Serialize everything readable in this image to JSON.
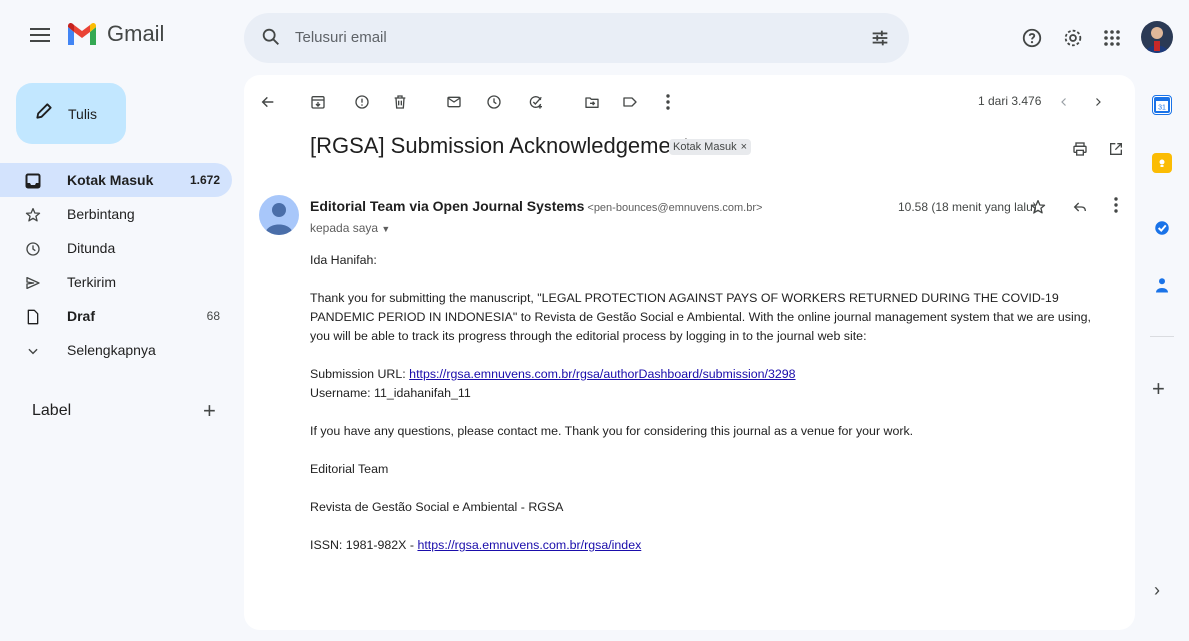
{
  "app": {
    "name": "Gmail"
  },
  "search": {
    "placeholder": "Telusuri email"
  },
  "compose": {
    "label": "Tulis"
  },
  "sidebar": {
    "items": [
      {
        "label": "Kotak Masuk",
        "count": "1.672",
        "icon": "inbox-icon"
      },
      {
        "label": "Berbintang",
        "count": "",
        "icon": "star-icon"
      },
      {
        "label": "Ditunda",
        "count": "",
        "icon": "clock-icon"
      },
      {
        "label": "Terkirim",
        "count": "",
        "icon": "send-icon"
      },
      {
        "label": "Draf",
        "count": "68",
        "icon": "draft-icon"
      },
      {
        "label": "Selengkapnya",
        "count": "",
        "icon": "chevron-down-icon"
      }
    ],
    "label_heading": "Label",
    "label_add": "+"
  },
  "toolbar": {
    "pager": "1 dari 3.476"
  },
  "email": {
    "subject": "[RGSA] Submission Acknowledgement",
    "tag": "Kotak Masuk",
    "tag_close": "×",
    "sender_name": "Editorial Team via Open Journal Systems",
    "sender_email": "<pen-bounces@emnuvens.com.br>",
    "to": "kepada saya",
    "time": "10.58 (18 menit yang lalu)",
    "greeting": "Ida Hanifah:",
    "paragraph1": "Thank you for submitting the manuscript, \"LEGAL PROTECTION AGAINST PAYS OF WORKERS RETURNED DURING THE COVID-19 PANDEMIC PERIOD IN INDONESIA\" to Revista de Gestão Social e Ambiental. With the online journal management system that we are using, you will be able to track its progress through the editorial process by logging in to the journal web site:",
    "submission_label": "Submission URL: ",
    "submission_url": "https://rgsa.emnuvens.com.br/rgsa/authorDashboard/submission/3298",
    "username": "Username: 11_idahanifah_11",
    "paragraph2": "If you have any questions, please contact me. Thank you for considering this journal as a venue for your work.",
    "sig1": "Editorial Team",
    "sig2": "Revista de Gestão Social e Ambiental - RGSA",
    "issn_label": "ISSN: 1981-982X - ",
    "issn_url": "https://rgsa.emnuvens.com.br/rgsa/index"
  },
  "colors": {
    "compose_bg": "#c2e7ff",
    "active_nav": "#d3e3fd",
    "link": "#1a0dab",
    "background": "#f6f8fc"
  }
}
